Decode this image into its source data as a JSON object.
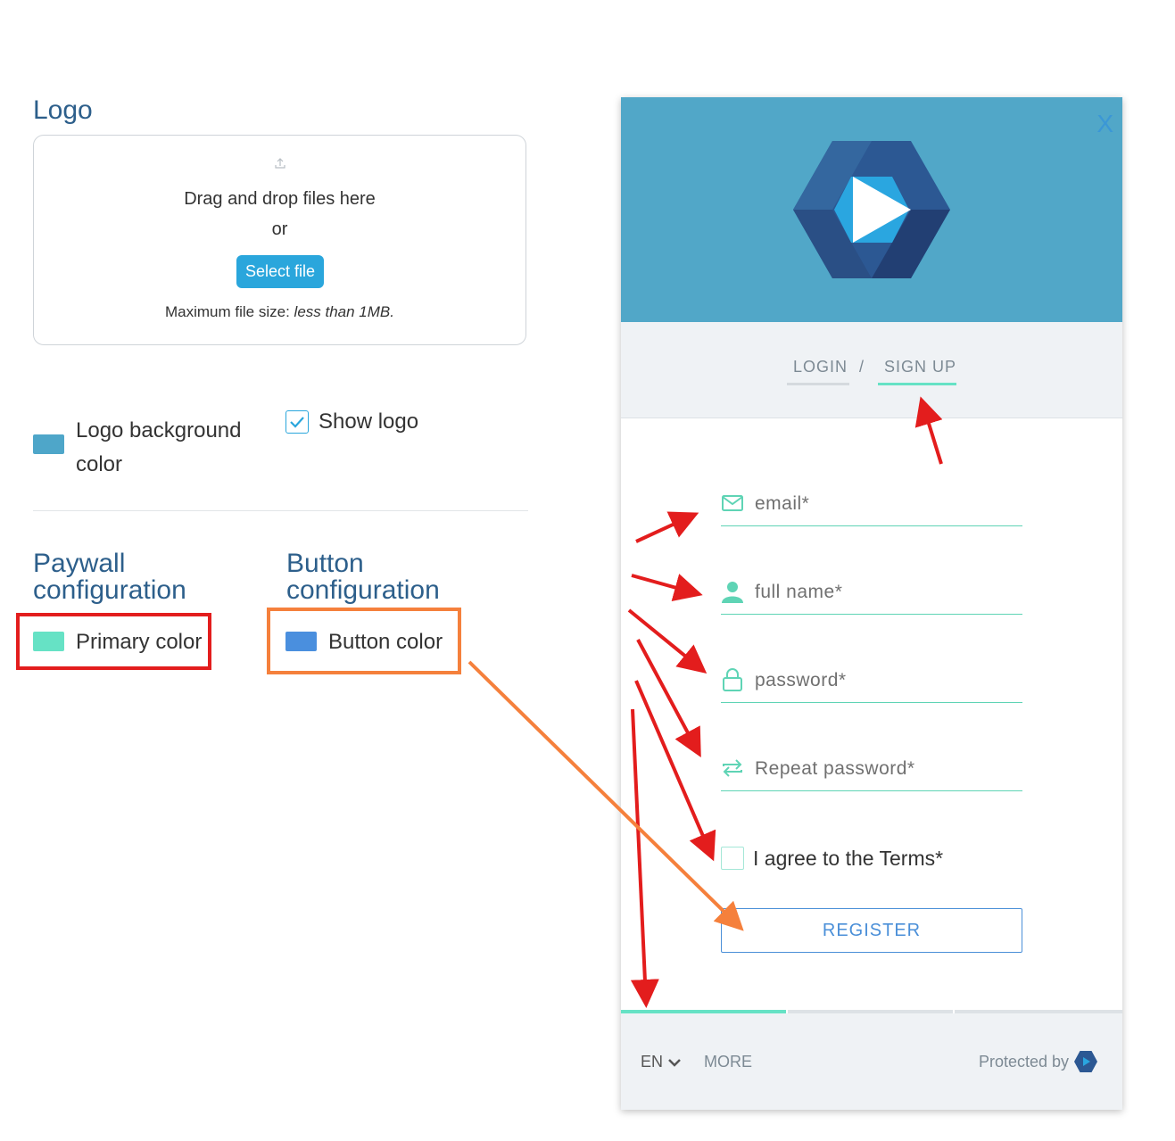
{
  "logo_section": {
    "title": "Logo",
    "dropzone": {
      "drag_text": "Drag and drop files here",
      "or_text": "or",
      "select_button": "Select file",
      "max_size_label": "Maximum file size:",
      "max_size_value": "less than 1MB."
    },
    "logo_background": {
      "label_line1": "Logo background",
      "label_line2": "color",
      "color": "#4ea6c9"
    },
    "show_logo": {
      "label": "Show logo",
      "checked": true
    }
  },
  "paywall_section": {
    "title_line1": "Paywall",
    "title_line2": "configuration",
    "primary_color": {
      "label": "Primary color",
      "color": "#66e2c5"
    }
  },
  "button_section": {
    "title_line1": "Button",
    "title_line2": "configuration",
    "button_color": {
      "label": "Button color",
      "color": "#4a8fde"
    }
  },
  "widget": {
    "close_label": "X",
    "header_color": "#51a7c8",
    "tabs": {
      "login": "LOGIN",
      "separator": "/",
      "signup": "SIGN UP"
    },
    "fields": {
      "email": "email*",
      "full_name": "full name*",
      "password": "password*",
      "repeat_password": "Repeat password*"
    },
    "terms_label": "I agree to the Terms*",
    "register_button": "REGISTER",
    "footer": {
      "language": "EN",
      "more": "MORE",
      "protected_by": "Protected by"
    }
  }
}
